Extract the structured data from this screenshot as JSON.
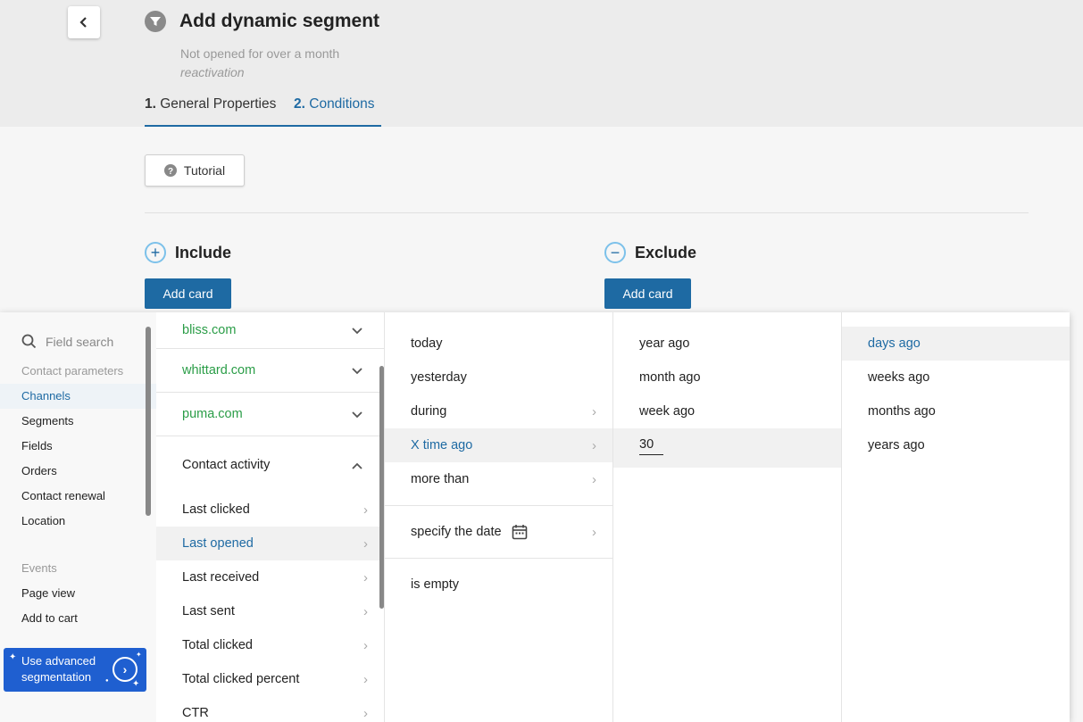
{
  "header": {
    "title": "Add dynamic segment",
    "subtitle": "Not opened for over a month",
    "subtitle_tag": "reactivation",
    "tabs": [
      {
        "num": "1.",
        "label": "General Properties"
      },
      {
        "num": "2.",
        "label": "Conditions"
      }
    ]
  },
  "tutorial_label": "Tutorial",
  "include": {
    "label": "Include",
    "add_card": "Add card"
  },
  "exclude": {
    "label": "Exclude",
    "add_card": "Add card"
  },
  "sidebar": {
    "search_placeholder": "Field search",
    "group1": "Contact parameters",
    "items1": [
      "Channels",
      "Segments",
      "Fields",
      "Orders",
      "Contact renewal",
      "Location"
    ],
    "group2": "Events",
    "items2": [
      "Page view",
      "Add to cart"
    ],
    "advanced": {
      "line1": "Use advanced",
      "line2": "segmentation"
    }
  },
  "column1": {
    "channels": [
      "bliss.com",
      "whittard.com",
      "puma.com"
    ],
    "group": "Contact activity",
    "items": [
      "Last clicked",
      "Last opened",
      "Last received",
      "Last sent",
      "Total clicked",
      "Total clicked percent",
      "CTR"
    ]
  },
  "column2": {
    "items": [
      "today",
      "yesterday",
      "during",
      "X time ago",
      "more than"
    ],
    "specify_date": "specify the date",
    "is_empty": "is empty"
  },
  "column3": {
    "items": [
      "year ago",
      "month ago",
      "week ago"
    ],
    "input_value": "30"
  },
  "column4": {
    "items": [
      "days ago",
      "weeks ago",
      "months ago",
      "years ago"
    ]
  },
  "colors": {
    "accent": "#1e6aa3",
    "channel_green": "#2a9d47",
    "advanced_blue": "#1f5fd0"
  }
}
